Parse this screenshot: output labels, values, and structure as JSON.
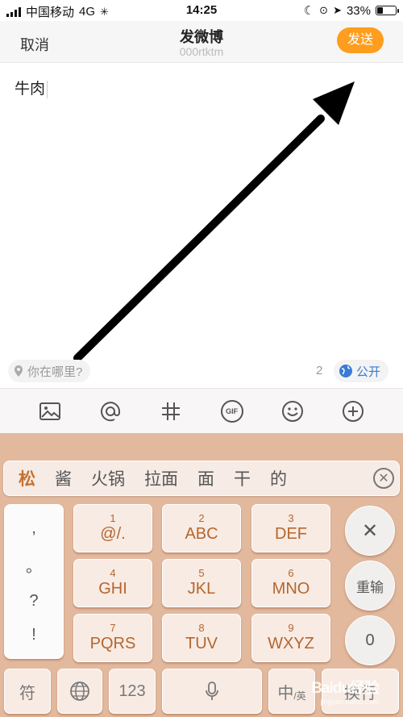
{
  "status_bar": {
    "carrier": "中国移动",
    "network": "4G",
    "time": "14:25",
    "battery": "33%",
    "battery_level": 0.33
  },
  "nav": {
    "cancel": "取消",
    "title": "发微博",
    "subtitle": "000rtktm",
    "send": "发送"
  },
  "compose": {
    "text": "牛肉"
  },
  "location": {
    "placeholder": "你在哪里?",
    "count": "2",
    "visibility": "公开"
  },
  "toolbar": {
    "icons": [
      "image-icon",
      "at-icon",
      "hashtag-icon",
      "gif-icon",
      "emoji-icon",
      "plus-icon"
    ],
    "gif_label": "GIF"
  },
  "candidates": [
    "松",
    "酱",
    "火锅",
    "拉面",
    "面",
    "干",
    "的"
  ],
  "keyboard": {
    "punct": [
      ",",
      "。",
      "?",
      "!"
    ],
    "keys": [
      {
        "num": "1",
        "letters": "@/."
      },
      {
        "num": "2",
        "letters": "ABC"
      },
      {
        "num": "3",
        "letters": "DEF"
      },
      {
        "num": "4",
        "letters": "GHI"
      },
      {
        "num": "5",
        "letters": "JKL"
      },
      {
        "num": "6",
        "letters": "MNO"
      },
      {
        "num": "7",
        "letters": "PQRS"
      },
      {
        "num": "8",
        "letters": "TUV"
      },
      {
        "num": "9",
        "letters": "WXYZ"
      }
    ],
    "delete": "✕",
    "reinput": "重输",
    "zero": "0",
    "symbol": "符",
    "numeric": "123",
    "lang": "中",
    "lang_sub": "/英",
    "confirm": "换行"
  },
  "watermark": {
    "main": "Baidu经验",
    "sub": "jingyan.baidu.com"
  },
  "colors": {
    "accent": "#ff9d1e",
    "keyboard_bg": "#e3b99e",
    "key_text": "#b5662f",
    "link": "#3a7bd5"
  }
}
